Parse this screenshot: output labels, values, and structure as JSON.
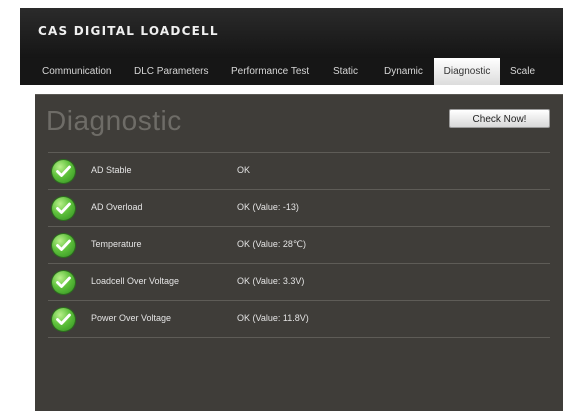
{
  "app": {
    "logo": "CAS DIGITAL LOADCELL"
  },
  "nav": {
    "tabs": [
      {
        "label": "Communication",
        "active": false
      },
      {
        "label": "DLC Parameters",
        "active": false
      },
      {
        "label": "Performance Test",
        "active": false
      },
      {
        "label": "Static",
        "active": false
      },
      {
        "label": "Dynamic",
        "active": false
      },
      {
        "label": "Diagnostic",
        "active": true
      },
      {
        "label": "Scale",
        "active": false
      }
    ]
  },
  "main": {
    "title": "Diagnostic",
    "check_button": "Check Now!",
    "rows": [
      {
        "icon": "check-circle-icon",
        "label": "AD Stable",
        "status": "OK"
      },
      {
        "icon": "check-circle-icon",
        "label": "AD Overload",
        "status": "OK (Value: -13)"
      },
      {
        "icon": "check-circle-icon",
        "label": "Temperature",
        "status": "OK (Value: 28℃)"
      },
      {
        "icon": "check-circle-icon",
        "label": "Loadcell Over Voltage",
        "status": "OK (Value: 3.3V)"
      },
      {
        "icon": "check-circle-icon",
        "label": "Power Over Voltage",
        "status": "OK (Value: 11.8V)"
      }
    ]
  },
  "colors": {
    "header_bg": "#1c1c1c",
    "panel_bg": "#3f3d39",
    "status_ok": "#4fb832"
  }
}
